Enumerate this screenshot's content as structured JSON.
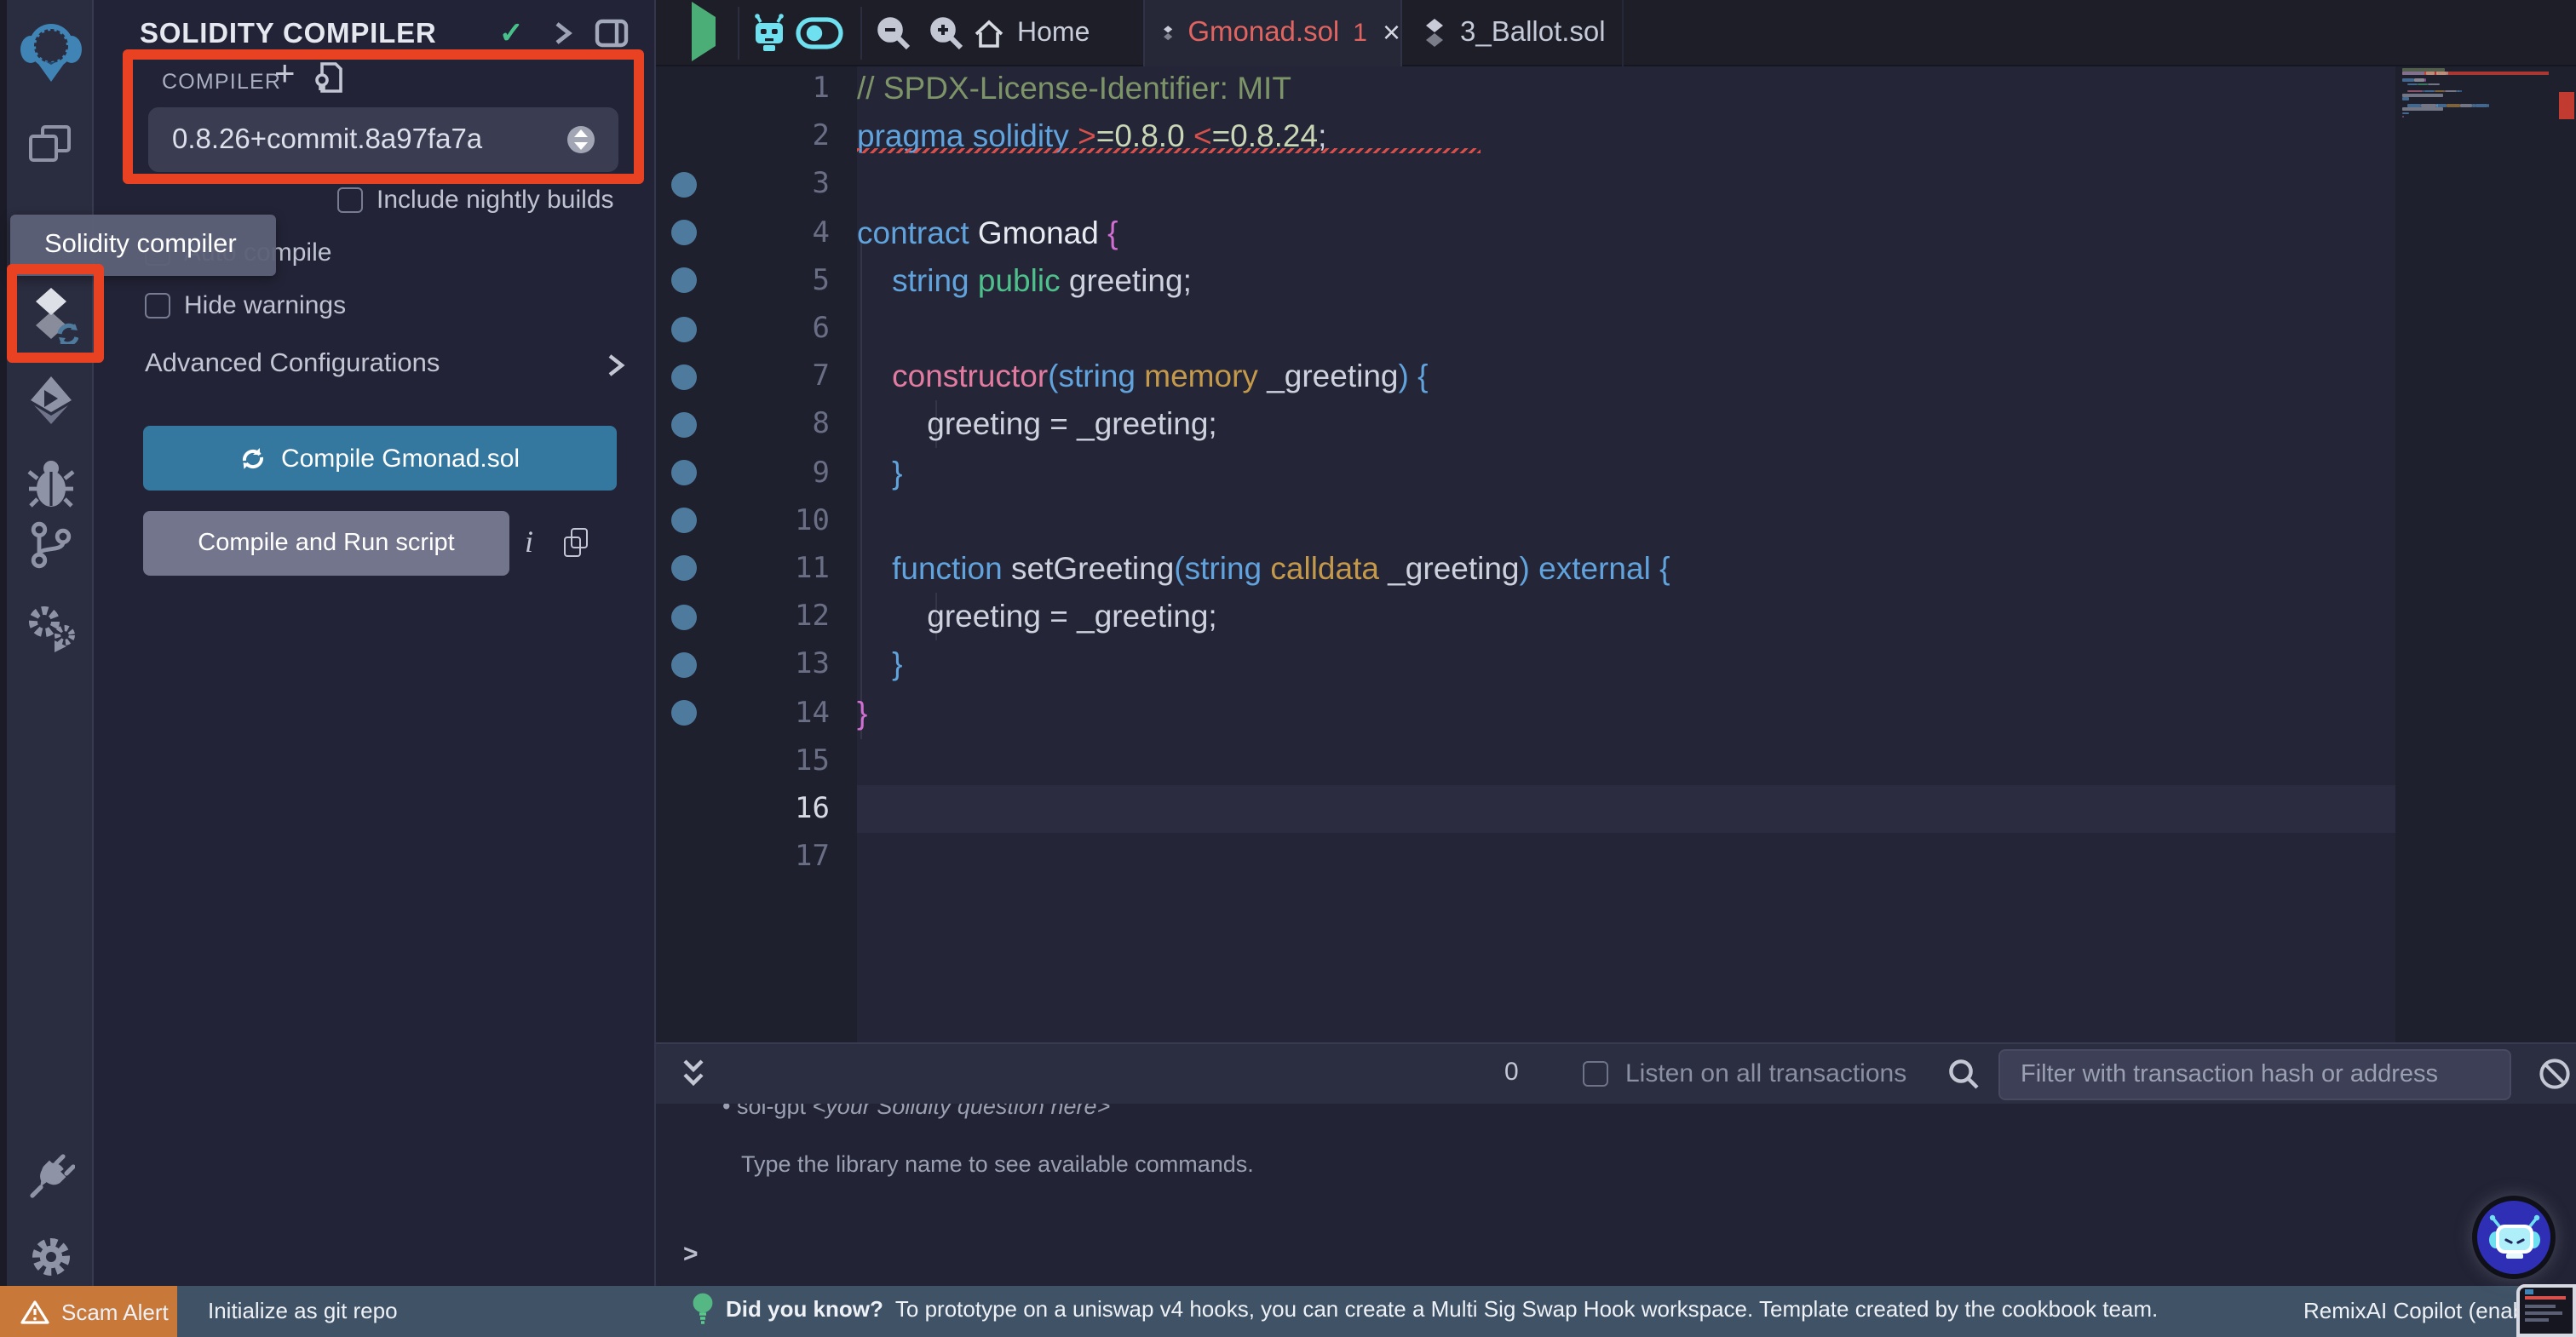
{
  "colors": {
    "accent_blue": "#35789f",
    "annotation_red": "#e84222",
    "error_red": "#e0645f",
    "status_bar": "#3f5266",
    "scam_orange": "#c8793a",
    "run_green": "#4cae77",
    "cyan": "#6fe0ef"
  },
  "annotations": {
    "tooltip_text": "Solidity compiler"
  },
  "side_panel": {
    "title": "SOLIDITY COMPILER",
    "section_label": "COMPILER",
    "add_glyph": "+",
    "version_value": "0.8.26+commit.8a97fa7a",
    "checkboxes": [
      {
        "label": "Include nightly builds",
        "checked": false
      },
      {
        "label": "Auto compile",
        "checked": false
      },
      {
        "label": "Hide warnings",
        "checked": false
      }
    ],
    "advanced_label": "Advanced Configurations",
    "compile_button_label": "Compile Gmonad.sol",
    "compile_run_label": "Compile and Run script",
    "info_glyph": "i",
    "check_glyph": "✓"
  },
  "topbar": {
    "tabs": [
      {
        "label": "Home"
      },
      {
        "label": "Gmonad.sol",
        "error_count": "1",
        "close_glyph": "×"
      },
      {
        "label": "3_Ballot.sol"
      }
    ]
  },
  "editor": {
    "current_line": 16,
    "gutter_dot_lines": [
      3,
      4,
      5,
      6,
      7,
      8,
      9,
      10,
      11,
      12,
      13,
      14
    ],
    "lines": [
      {
        "n": 1,
        "t": [
          [
            "c",
            "// SPDX-License-Identifier: MIT"
          ]
        ]
      },
      {
        "n": 2,
        "error": true,
        "t": [
          [
            "k",
            "pragma solidity "
          ],
          [
            "o",
            ">"
          ],
          [
            "v",
            "=0.8.0"
          ],
          [
            "w",
            " "
          ],
          [
            "o",
            "<"
          ],
          [
            "v",
            "=0.8.24"
          ],
          [
            "w",
            ";"
          ]
        ]
      },
      {
        "n": 3,
        "t": []
      },
      {
        "n": 4,
        "t": [
          [
            "k",
            "contract "
          ],
          [
            "n2",
            "Gmonad "
          ],
          [
            "m",
            "{"
          ]
        ]
      },
      {
        "n": 5,
        "t": [
          [
            "w",
            "    "
          ],
          [
            "k",
            "string "
          ],
          [
            "t2",
            "public "
          ],
          [
            "w",
            "greeting;"
          ]
        ]
      },
      {
        "n": 6,
        "t": []
      },
      {
        "n": 7,
        "t": [
          [
            "w",
            "    "
          ],
          [
            "p",
            "constructor"
          ],
          [
            "k",
            "("
          ],
          [
            "k",
            "string "
          ],
          [
            "g",
            "memory "
          ],
          [
            "w",
            "_greeting"
          ],
          [
            "k",
            ") "
          ],
          [
            "k",
            "{"
          ]
        ]
      },
      {
        "n": 8,
        "t": [
          [
            "w",
            "        greeting = _greeting;"
          ]
        ]
      },
      {
        "n": 9,
        "t": [
          [
            "k",
            "    }"
          ]
        ]
      },
      {
        "n": 10,
        "t": []
      },
      {
        "n": 11,
        "t": [
          [
            "w",
            "    "
          ],
          [
            "k",
            "function "
          ],
          [
            "w",
            "setGreeting"
          ],
          [
            "k",
            "("
          ],
          [
            "k",
            "string "
          ],
          [
            "g",
            "calldata "
          ],
          [
            "w",
            "_greeting"
          ],
          [
            "k",
            ") "
          ],
          [
            "k",
            "external "
          ],
          [
            "k",
            "{"
          ]
        ]
      },
      {
        "n": 12,
        "t": [
          [
            "w",
            "        greeting = _greeting;"
          ]
        ]
      },
      {
        "n": 13,
        "t": [
          [
            "k",
            "    }"
          ]
        ]
      },
      {
        "n": 14,
        "t": [
          [
            "m",
            "}"
          ]
        ]
      },
      {
        "n": 15,
        "t": []
      },
      {
        "n": 16,
        "t": []
      },
      {
        "n": 17,
        "t": []
      }
    ]
  },
  "terminal": {
    "count": "0",
    "listen_label": "Listen on all transactions",
    "filter_placeholder": "Filter with transaction hash or address",
    "line1_bullet": "• ",
    "line1_cmd": "sol-gpt ",
    "line1_arg": "<your Solidity question here>",
    "line2": "Type the library name to see available commands.",
    "prompt": ">"
  },
  "statusbar": {
    "scam_alert": "Scam Alert",
    "git_label": "Initialize as git repo",
    "tip_bold": "Did you know?",
    "tip_text": "To prototype on a uniswap v4 hooks, you can create a Multi Sig Swap Hook workspace. Template created by the cookbook team.",
    "copilot_label": "RemixAI Copilot (enabled)"
  }
}
